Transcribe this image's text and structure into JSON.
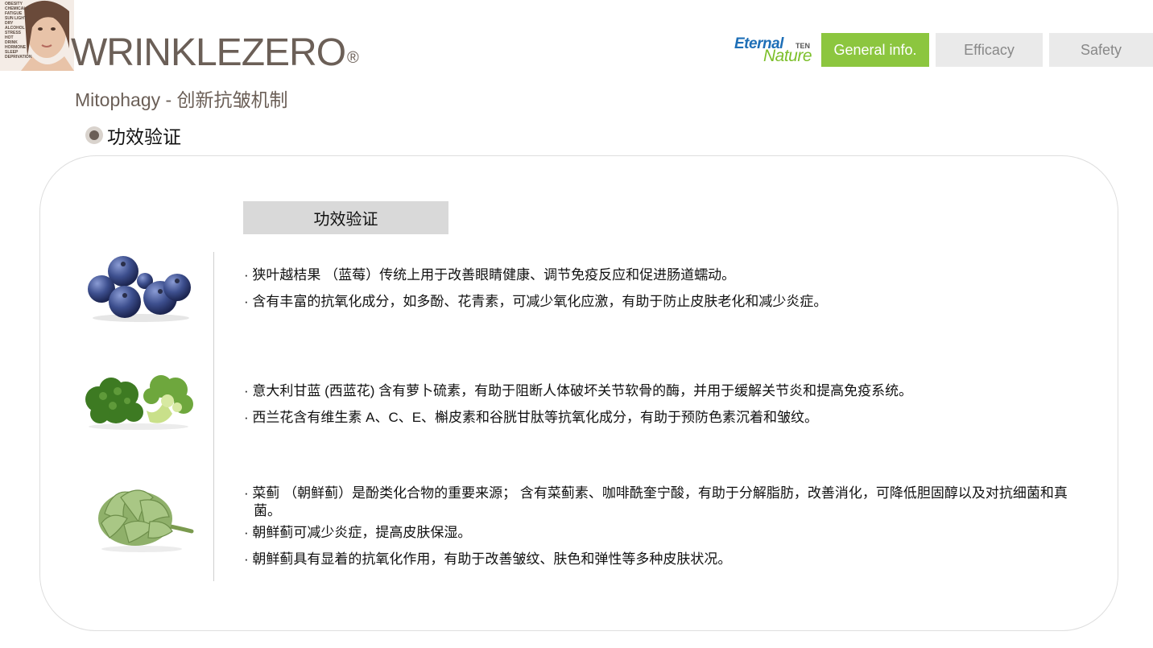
{
  "header": {
    "brand": "WRINKLEZERO",
    "brand_mark": "®",
    "logo_word1": "Eternal",
    "logo_word2": "Nature",
    "logo_sup": "TEN",
    "tabs": [
      {
        "label": "General info.",
        "active": true
      },
      {
        "label": "Efficacy",
        "active": false
      },
      {
        "label": "Safety",
        "active": false
      }
    ],
    "hero_photo_text": [
      "OBESITY",
      "CHEMICALS",
      "FATIGUE",
      "SUN LIGHT",
      "DRY",
      "ALCOHOL",
      "STRESS",
      "HOT",
      "DRINK",
      "HORMONE",
      "SLEEP DEPRIVATION"
    ]
  },
  "subtitle": "Mitophagy - 创新抗皱机制",
  "section_heading": "功效验证",
  "card": {
    "label": "功效验证",
    "items": [
      {
        "image": "blueberries",
        "lines": [
          "· 狭叶越桔果 （蓝莓）传统上用于改善眼睛健康、调节免疫反应和促进肠道蠕动。",
          "· 含有丰富的抗氧化成分，如多酚、花青素，可减少氧化应激，有助于防止皮肤老化和减少炎症。"
        ]
      },
      {
        "image": "broccoli",
        "lines": [
          "· 意大利甘蓝 (西蓝花) 含有萝卜硫素，有助于阻断人体破坏关节软骨的酶，并用于缓解关节炎和提高免疫系统。",
          "· 西兰花含有维生素 A、C、E、槲皮素和谷胱甘肽等抗氧化成分，有助于预防色素沉着和皱纹。"
        ]
      },
      {
        "image": "artichoke",
        "lines": [
          "· 菜蓟 （朝鲜蓟）是酚类化合物的重要来源； 含有菜蓟素、咖啡酰奎宁酸，有助于分解脂肪，改善消化，可降低胆固醇以及对抗细菌和真菌。",
          "· 朝鲜蓟可减少炎症，提高皮肤保湿。",
          "· 朝鲜蓟具有显着的抗氧化作用，有助于改善皱纹、肤色和弹性等多种皮肤状况。"
        ]
      }
    ]
  },
  "colors": {
    "brand_brown": "#6b5f57",
    "tab_active": "#8cc63f",
    "tab_inactive": "#eaeaea",
    "logo_blue": "#1e6fb7",
    "logo_green": "#7cbf2a"
  }
}
